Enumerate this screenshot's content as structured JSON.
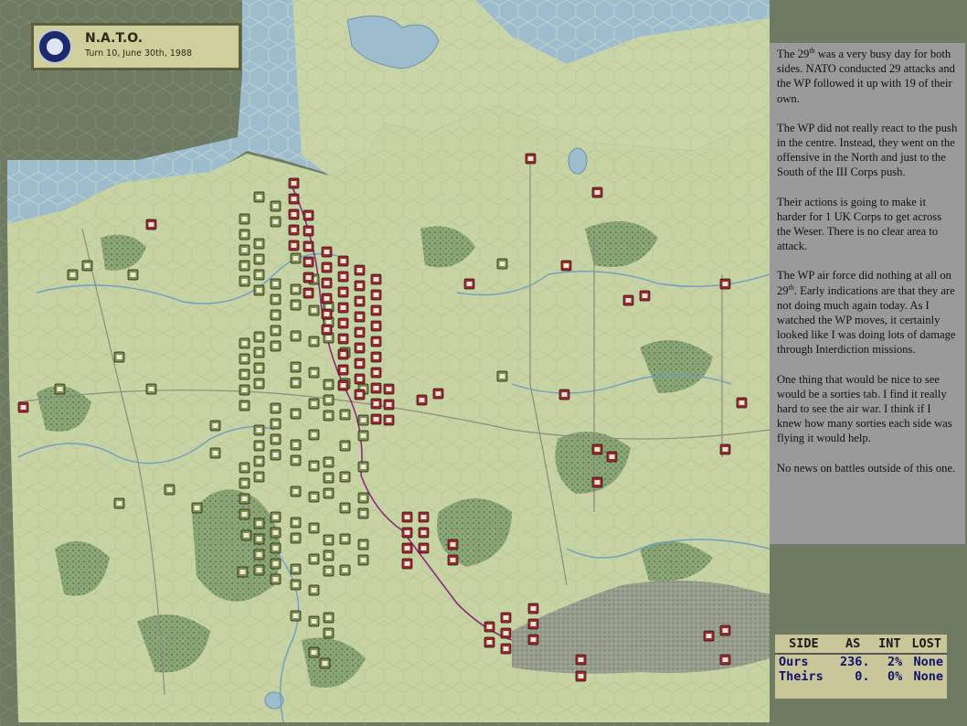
{
  "header": {
    "faction": "N.A.T.O.",
    "turn_info": "Turn 10, June 30th, 1988",
    "logo_icon": "nato-compass-icon"
  },
  "report": {
    "p1": {
      "before": "The 29",
      "sup": "th",
      "after": " was a very busy day for both sides.  NATO conducted 29 attacks and the WP followed it up with 19 of their own."
    },
    "p2": "The WP did not really react to the push in the centre.  Instead, they went on the offensive in the North and just to the South of the III Corps push.",
    "p3": "Their actions is going to make it harder for 1 UK Corps to get across the Weser.  There is no clear area to attack.",
    "p4": {
      "before": "The WP air force did nothing at all on 29",
      "sup": "th",
      "after": ".  Early indications are that they are not doing much again today. As I watched the WP moves, it certainly looked like I was doing lots of damage through Interdiction missions."
    },
    "p5": "One thing that would be nice to see would be a sorties tab.  I find it really hard to see the air war.  I think if I knew how many sorties each side was flying it would help.",
    "p6": "No news on battles outside of this one."
  },
  "stats": {
    "columns": [
      "SIDE",
      "AS",
      "INT",
      "LOST"
    ],
    "rows": [
      {
        "side": "Ours",
        "as": "236.",
        "int": "2%",
        "lost": "None"
      },
      {
        "side": "Theirs",
        "as": "0.",
        "int": "0%",
        "lost": "None"
      }
    ]
  },
  "colors": {
    "land": "#c7d3a3",
    "water": "#9dbdcf",
    "forest": "#7f9e6e",
    "offmap": "#6f7a63",
    "nato_unit": "#7f8f48",
    "wp_unit": "#a3262d",
    "panel": "#9a9a9a"
  }
}
